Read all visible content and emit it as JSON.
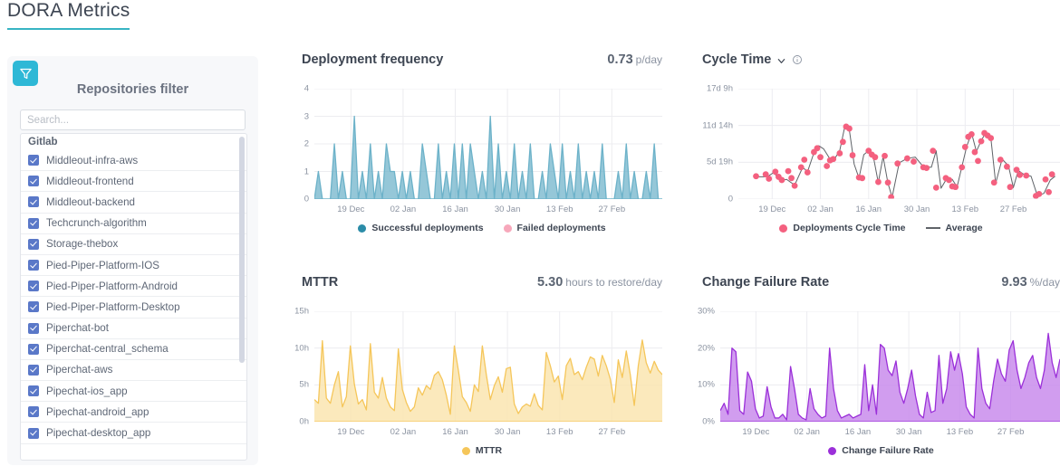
{
  "header": {
    "title": "DORA Metrics",
    "accent": "#37b4c3"
  },
  "sidebar": {
    "filter_icon": "funnel-icon",
    "title": "Repositories filter",
    "search_placeholder": "Search...",
    "search_value": "",
    "group_label": "Gitlab",
    "repositories": [
      {
        "label": "Middleout-infra-aws",
        "checked": true
      },
      {
        "label": "Middleout-frontend",
        "checked": true
      },
      {
        "label": "Middleout-backend",
        "checked": true
      },
      {
        "label": "Techcrunch-algorithm",
        "checked": true
      },
      {
        "label": "Storage-thebox",
        "checked": true
      },
      {
        "label": "Pied-Piper-Platform-IOS",
        "checked": true
      },
      {
        "label": "Pied-Piper-Platform-Android",
        "checked": true
      },
      {
        "label": "Pied-Piper-Platform-Desktop",
        "checked": true
      },
      {
        "label": "Piperchat-bot",
        "checked": true
      },
      {
        "label": "Piperchat-central_schema",
        "checked": true
      },
      {
        "label": "Piperchat-aws",
        "checked": true
      },
      {
        "label": "Pipechat-ios_app",
        "checked": true
      },
      {
        "label": "Pipechat-android_app",
        "checked": true
      },
      {
        "label": "Pipechat-desktop_app",
        "checked": true
      }
    ],
    "checkbox_color": "#5a78c8"
  },
  "chart_data": [
    {
      "id": "deployment-frequency",
      "type": "area",
      "title": "Deployment frequency",
      "value": "0.73",
      "unit": "p/day",
      "color": "#6cb2c9",
      "ylabel": "",
      "xlabel": "",
      "yticks": [
        "0",
        "1",
        "2",
        "3",
        "4"
      ],
      "ylim": [
        0,
        4
      ],
      "xticks": [
        "19 Dec",
        "02 Jan",
        "16 Jan",
        "30 Jan",
        "13 Feb",
        "27 Feb"
      ],
      "xtick_pos": [
        0.105,
        0.255,
        0.405,
        0.555,
        0.705,
        0.855
      ],
      "legend_position": "bottom",
      "legend": [
        {
          "name": "Successful deployments",
          "color": "#2b8ca8",
          "marker": "dot"
        },
        {
          "name": "Failed deployments",
          "color": "#f7a8bb",
          "marker": "dot"
        }
      ],
      "values": [
        0,
        1,
        0,
        0,
        0,
        2,
        0,
        1,
        0,
        0,
        3,
        0,
        1,
        0,
        2,
        0,
        1,
        0,
        2,
        1,
        1,
        0,
        1,
        0,
        1,
        0,
        0,
        2,
        1,
        0,
        0,
        2,
        0,
        1,
        0,
        2,
        0,
        2,
        0,
        2,
        1,
        0,
        1,
        0,
        3,
        0,
        2,
        0,
        1,
        0,
        2,
        0,
        1,
        0,
        2,
        0,
        0,
        1,
        0,
        2,
        1,
        0,
        2,
        0,
        1,
        0,
        2,
        0,
        1,
        0,
        1,
        0,
        2,
        0,
        0,
        0,
        1,
        0,
        2,
        0,
        1,
        0,
        0,
        1,
        0,
        2,
        0,
        0
      ]
    },
    {
      "id": "cycle-time",
      "type": "scatter",
      "title": "Cycle Time",
      "has_dropdown": true,
      "has_info": true,
      "value": "",
      "unit": "",
      "color": "#f4607f",
      "line_color": "#5f6368",
      "yticks": [
        "0",
        "5d 19h",
        "11d 14h",
        "17d 9h"
      ],
      "ylim": [
        0,
        17.375
      ],
      "xticks": [
        "19 Dec",
        "02 Jan",
        "16 Jan",
        "30 Jan",
        "13 Feb",
        "27 Feb"
      ],
      "xtick_pos": [
        0.105,
        0.255,
        0.405,
        0.555,
        0.705,
        0.855
      ],
      "legend_position": "bottom",
      "legend": [
        {
          "name": "Deployments Cycle Time",
          "color": "#f4607f",
          "marker": "dot"
        },
        {
          "name": "Average",
          "color": "#5f6368",
          "marker": "line"
        }
      ],
      "points": [
        [
          0.055,
          3.6
        ],
        [
          0.085,
          3.9
        ],
        [
          0.095,
          3.2
        ],
        [
          0.115,
          4.3
        ],
        [
          0.125,
          3.5
        ],
        [
          0.135,
          3.0
        ],
        [
          0.155,
          4.4
        ],
        [
          0.165,
          3.3
        ],
        [
          0.175,
          2.1
        ],
        [
          0.195,
          5.0
        ],
        [
          0.205,
          6.2
        ],
        [
          0.215,
          4.2
        ],
        [
          0.235,
          7.4
        ],
        [
          0.245,
          8.0
        ],
        [
          0.255,
          6.6
        ],
        [
          0.275,
          5.2
        ],
        [
          0.285,
          6.1
        ],
        [
          0.295,
          6.3
        ],
        [
          0.315,
          7.2
        ],
        [
          0.325,
          9.0
        ],
        [
          0.335,
          11.4
        ],
        [
          0.345,
          11.1
        ],
        [
          0.355,
          6.9
        ],
        [
          0.375,
          3.4
        ],
        [
          0.385,
          3.3
        ],
        [
          0.405,
          7.6
        ],
        [
          0.415,
          7.0
        ],
        [
          0.425,
          6.6
        ],
        [
          0.435,
          2.7
        ],
        [
          0.455,
          6.8
        ],
        [
          0.465,
          2.6
        ],
        [
          0.475,
          0.3
        ],
        [
          0.495,
          5.6
        ],
        [
          0.525,
          6.4
        ],
        [
          0.545,
          5.9
        ],
        [
          0.575,
          5.0
        ],
        [
          0.585,
          4.9
        ],
        [
          0.605,
          7.6
        ],
        [
          0.615,
          1.8
        ],
        [
          0.645,
          3.3
        ],
        [
          0.655,
          3.0
        ],
        [
          0.665,
          2.0
        ],
        [
          0.675,
          1.9
        ],
        [
          0.695,
          5.0
        ],
        [
          0.705,
          8.2
        ],
        [
          0.715,
          9.8
        ],
        [
          0.725,
          10.2
        ],
        [
          0.735,
          7.4
        ],
        [
          0.745,
          6.0
        ],
        [
          0.755,
          9.1
        ],
        [
          0.765,
          10.4
        ],
        [
          0.775,
          10.0
        ],
        [
          0.785,
          9.6
        ],
        [
          0.795,
          2.6
        ],
        [
          0.815,
          6.2
        ],
        [
          0.835,
          5.1
        ],
        [
          0.845,
          1.9
        ],
        [
          0.865,
          4.6
        ],
        [
          0.875,
          3.8
        ],
        [
          0.895,
          3.7
        ],
        [
          0.925,
          0.5
        ],
        [
          0.935,
          0.8
        ],
        [
          0.955,
          3.1
        ],
        [
          0.965,
          1.1
        ],
        [
          0.975,
          3.9
        ]
      ],
      "average_line": [
        [
          0.05,
          3.5
        ],
        [
          0.09,
          3.5
        ],
        [
          0.11,
          4.2
        ],
        [
          0.13,
          2.9
        ],
        [
          0.15,
          3.1
        ],
        [
          0.175,
          2.2
        ],
        [
          0.2,
          5.0
        ],
        [
          0.215,
          4.3
        ],
        [
          0.235,
          7.3
        ],
        [
          0.25,
          8.4
        ],
        [
          0.265,
          7.9
        ],
        [
          0.285,
          6.3
        ],
        [
          0.3,
          6.4
        ],
        [
          0.315,
          7.6
        ],
        [
          0.33,
          11.2
        ],
        [
          0.345,
          10.9
        ],
        [
          0.36,
          5.5
        ],
        [
          0.375,
          3.3
        ],
        [
          0.39,
          7.0
        ],
        [
          0.405,
          7.6
        ],
        [
          0.42,
          6.6
        ],
        [
          0.435,
          2.6
        ],
        [
          0.45,
          6.7
        ],
        [
          0.465,
          2.5
        ],
        [
          0.478,
          0.3
        ],
        [
          0.5,
          5.7
        ],
        [
          0.525,
          6.4
        ],
        [
          0.55,
          6.6
        ],
        [
          0.575,
          5.1
        ],
        [
          0.6,
          5.0
        ],
        [
          0.615,
          7.6
        ],
        [
          0.63,
          1.7
        ],
        [
          0.65,
          3.4
        ],
        [
          0.665,
          3.1
        ],
        [
          0.68,
          1.9
        ],
        [
          0.695,
          5.1
        ],
        [
          0.71,
          8.3
        ],
        [
          0.725,
          10.4
        ],
        [
          0.74,
          7.5
        ],
        [
          0.755,
          9.2
        ],
        [
          0.77,
          10.5
        ],
        [
          0.785,
          9.6
        ],
        [
          0.8,
          2.5
        ],
        [
          0.82,
          6.3
        ],
        [
          0.84,
          5.2
        ],
        [
          0.855,
          1.8
        ],
        [
          0.87,
          4.5
        ],
        [
          0.89,
          3.8
        ],
        [
          0.91,
          3.6
        ],
        [
          0.93,
          0.5
        ],
        [
          0.95,
          0.9
        ],
        [
          0.97,
          3.0
        ],
        [
          0.985,
          3.6
        ]
      ]
    },
    {
      "id": "mttr",
      "type": "area",
      "title": "MTTR",
      "value": "5.30",
      "unit": "hours to restore/day",
      "color": "#f5c65a",
      "fill_color": "#fae5b0",
      "yticks": [
        "0h",
        "5h",
        "10h",
        "15h"
      ],
      "ylim": [
        0,
        15
      ],
      "xticks": [
        "19 Dec",
        "02 Jan",
        "16 Jan",
        "30 Jan",
        "13 Feb",
        "27 Feb"
      ],
      "xtick_pos": [
        0.105,
        0.255,
        0.405,
        0.555,
        0.705,
        0.855
      ],
      "legend_position": "bottom",
      "legend": [
        {
          "name": "MTTR",
          "color": "#f5c65a",
          "marker": "dot"
        }
      ],
      "values": [
        3.0,
        2.5,
        11.0,
        3.2,
        2.5,
        5.0,
        6.8,
        2.0,
        3.4,
        10.3,
        5.1,
        2.4,
        3.0,
        1.6,
        10.6,
        4.0,
        3.2,
        6.0,
        3.2,
        2.0,
        1.5,
        9.9,
        4.4,
        2.6,
        1.4,
        2.0,
        4.6,
        3.6,
        4.9,
        4.4,
        6.3,
        6.8,
        5.7,
        3.6,
        1.0,
        10.3,
        7.0,
        3.4,
        2.6,
        1.4,
        5.0,
        4.1,
        10.3,
        6.4,
        3.0,
        4.9,
        6.1,
        4.0,
        7.2,
        7.4,
        2.4,
        1.1,
        2.0,
        2.4,
        2.1,
        3.8,
        2.2,
        1.6,
        9.4,
        7.6,
        5.4,
        6.2,
        3.0,
        7.6,
        8.6,
        6.4,
        6.8,
        5.7,
        7.4,
        8.8,
        8.5,
        6.2,
        9.0,
        7.6,
        5.8,
        2.6,
        8.4,
        6.0,
        9.6,
        6.4,
        2.2,
        7.6,
        11.1,
        8.0,
        6.6,
        8.2,
        7.0,
        6.4
      ]
    },
    {
      "id": "change-failure-rate",
      "type": "area",
      "title": "Change Failure Rate",
      "value": "9.93",
      "unit": "%/day",
      "color": "#9b30d9",
      "fill_color": "#c98cec",
      "yticks": [
        "0%",
        "10%",
        "20%",
        "30%"
      ],
      "ylim": [
        0,
        30
      ],
      "xticks": [
        "19 Dec",
        "02 Jan",
        "16 Jan",
        "30 Jan",
        "13 Feb",
        "27 Feb"
      ],
      "xtick_pos": [
        0.105,
        0.255,
        0.405,
        0.555,
        0.705,
        0.855
      ],
      "legend_position": "bottom",
      "legend": [
        {
          "name": "Change Failure Rate",
          "color": "#9b30d9",
          "marker": "dot"
        }
      ],
      "values": [
        3.0,
        5.0,
        2.0,
        20.0,
        19.0,
        3.0,
        2.0,
        13.5,
        11.0,
        3.5,
        1.0,
        1.5,
        9.5,
        4.0,
        1.0,
        1.0,
        2.0,
        0.5,
        15.0,
        9.0,
        2.0,
        1.0,
        0.5,
        9.0,
        3.5,
        2.0,
        1.0,
        1.5,
        20.0,
        9.0,
        3.0,
        1.0,
        1.5,
        2.0,
        1.0,
        1.5,
        2.0,
        15.5,
        3.0,
        10.0,
        2.0,
        21.0,
        20.0,
        14.0,
        12.5,
        16.5,
        8.0,
        5.0,
        9.0,
        14.0,
        7.0,
        2.0,
        1.0,
        8.0,
        2.5,
        3.0,
        18.0,
        5.0,
        9.0,
        19.0,
        14.0,
        18.5,
        13.0,
        4.0,
        2.0,
        1.0,
        20.0,
        9.0,
        5.0,
        3.5,
        11.0,
        17.0,
        13.0,
        11.0,
        19.5,
        22.0,
        14.0,
        9.0,
        12.0,
        16.0,
        18.0,
        12.0,
        9.0,
        14.0,
        24.0,
        16.0,
        12.0,
        17.0
      ]
    }
  ]
}
